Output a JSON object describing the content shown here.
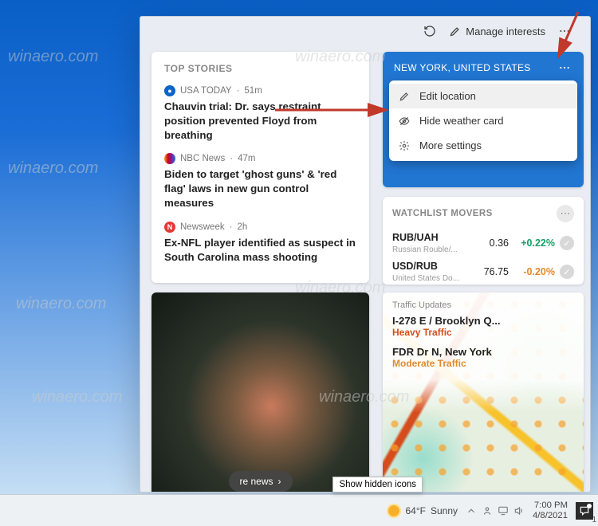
{
  "topbar": {
    "manage_label": "Manage interests"
  },
  "top_stories": {
    "title": "TOP STORIES",
    "items": [
      {
        "source": "USA TODAY",
        "time": "51m",
        "headline": "Chauvin trial: Dr. says restraint position prevented Floyd from breathing"
      },
      {
        "source": "NBC News",
        "time": "47m",
        "headline": "Biden to target 'ghost guns' & 'red flag' laws in new gun control measures"
      },
      {
        "source": "Newsweek",
        "time": "2h",
        "headline": "Ex-NFL player identified as suspect in South Carolina mass shooting"
      }
    ]
  },
  "weather": {
    "location": "NEW YORK, UNITED STATES",
    "menu": [
      {
        "icon": "pencil",
        "label": "Edit location"
      },
      {
        "icon": "eye-off",
        "label": "Hide weather card"
      },
      {
        "icon": "gear",
        "label": "More settings"
      }
    ]
  },
  "watchlist": {
    "title": "WATCHLIST MOVERS",
    "items": [
      {
        "pair": "RUB/UAH",
        "sub": "Russian Rouble/...",
        "price": "0.36",
        "change": "+0.22%",
        "dir": "up"
      },
      {
        "pair": "USD/RUB",
        "sub": "United States Do...",
        "price": "76.75",
        "change": "-0.20%",
        "dir": "dn"
      }
    ]
  },
  "more_news_label": "re news",
  "traffic": {
    "title": "Traffic Updates",
    "items": [
      {
        "road": "I-278 E / Brooklyn Q...",
        "status": "Heavy Traffic",
        "cls": "heavy"
      },
      {
        "road": "FDR Dr N, New York",
        "status": "Moderate Traffic",
        "cls": "mod"
      }
    ]
  },
  "taskbar": {
    "weather": {
      "temp": "64°F",
      "cond": "Sunny"
    },
    "tooltip": "Show hidden icons",
    "time": "7:00 PM",
    "date": "4/8/2021",
    "notif_count": "1"
  }
}
